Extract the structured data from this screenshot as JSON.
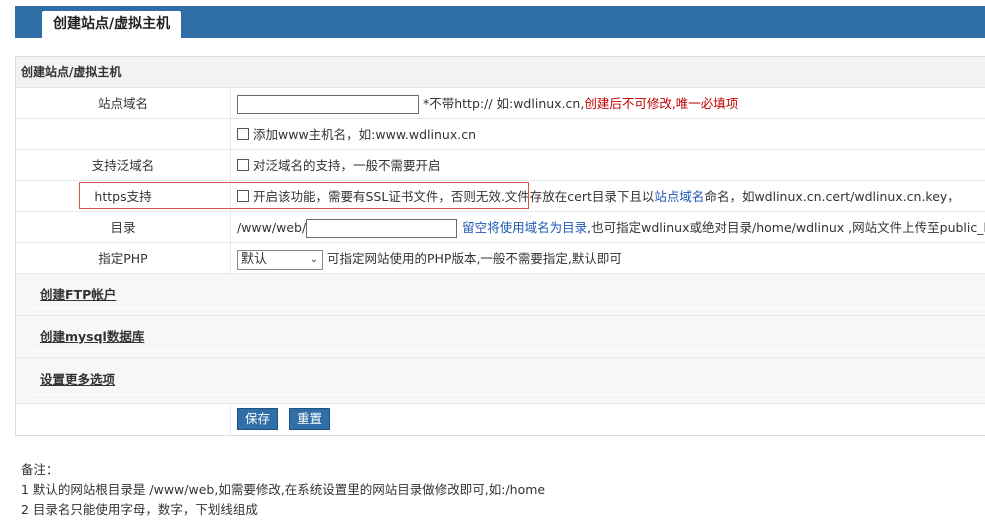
{
  "header": {
    "tab_label": "创建站点/虚拟主机"
  },
  "form": {
    "section_title": "创建站点/虚拟主机",
    "domain": {
      "label": "站点域名",
      "value": "",
      "hint_prefix": "*不带http:// 如:wdlinux.cn,",
      "hint_required": "创建后不可修改,唯一必填项"
    },
    "add_www": {
      "label": "添加www主机名，如:www.wdlinux.cn",
      "checked": false
    },
    "wildcard": {
      "label": "支持泛域名",
      "option_label": "对泛域名的支持，一般不需要开启",
      "checked": false
    },
    "https": {
      "label": "https支持",
      "option_text_1": "开启该功能，需要有SSL证书文件，否则无效.文件存放在cert目录下且以",
      "option_link": "站点域名",
      "option_text_2": "命名，如wdlinux.cn.cert/wdlinux.cn.key，",
      "checked": false
    },
    "directory": {
      "label": "目录",
      "prefix": "/www/web/",
      "value": "",
      "hint_link": "留空将使用域名为目录",
      "hint_text": ",也可指定wdlinux或绝对目录/home/wdlinux ,网站文件上传至public_html"
    },
    "php": {
      "label": "指定PHP",
      "selected": "默认",
      "hint": "可指定网站使用的PHP版本,一般不需要指定,默认即可"
    }
  },
  "sections": {
    "ftp": "创建FTP帐户",
    "mysql": "创建mysql数据库",
    "more": "设置更多选项"
  },
  "buttons": {
    "save": "保存",
    "reset": "重置"
  },
  "notes": {
    "title": "备注：",
    "line1": "1 默认的网站根目录是 /www/web,如需要修改,在系统设置里的网站目录做修改即可,如:/home",
    "line2": "2 目录名只能使用字母，数字，下划线组成"
  },
  "colors": {
    "header_bg": "#2f6ea6",
    "button_bg": "#2f6ea6",
    "required": "#c00000",
    "link": "#1f57b5"
  }
}
